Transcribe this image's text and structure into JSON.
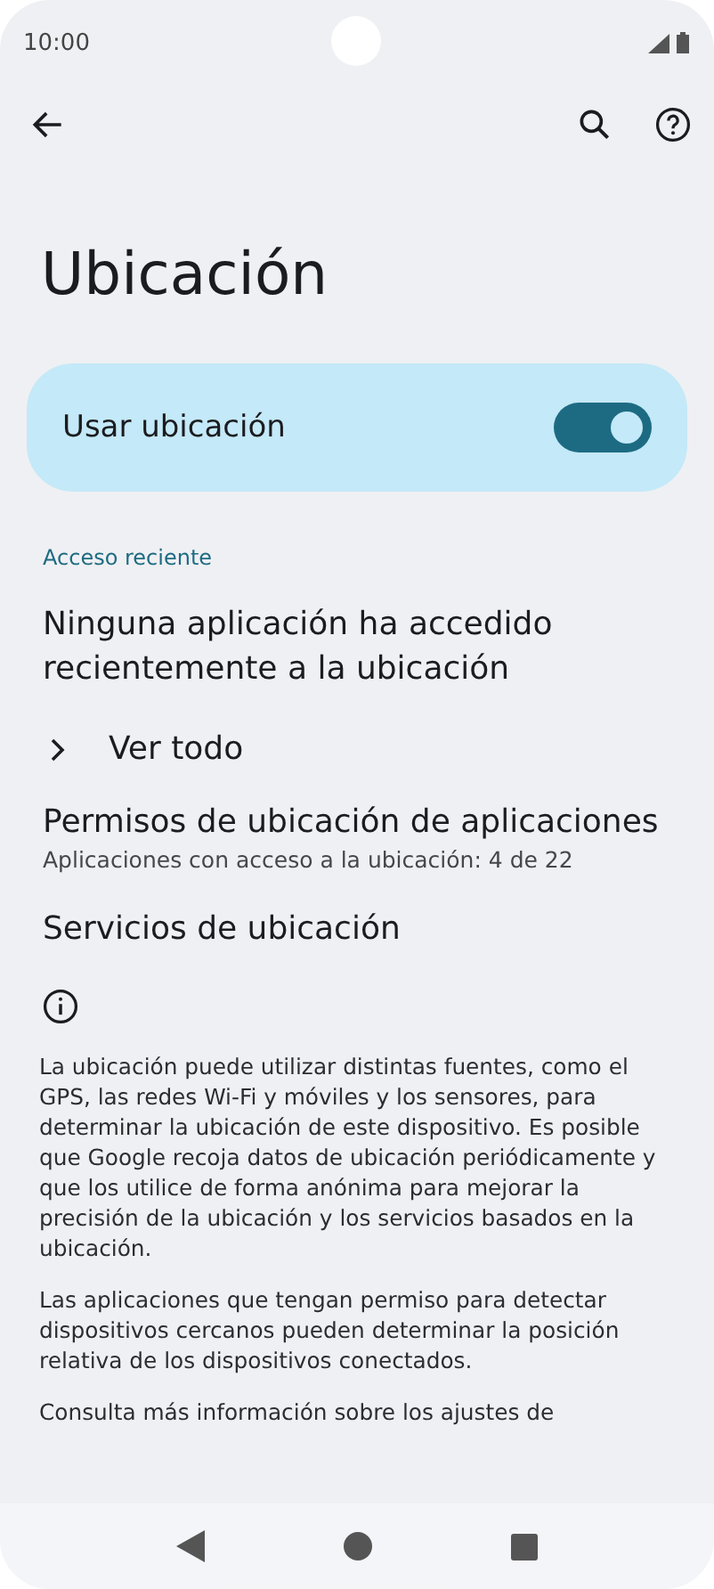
{
  "status_bar": {
    "time": "10:00"
  },
  "title": "Ubicación",
  "main_toggle": {
    "label": "Usar ubicación",
    "on": true
  },
  "section_header": "Acceso reciente",
  "recent_message": "Ninguna aplicación ha accedido recientemente a la ubicación",
  "see_all": {
    "label": "Ver todo"
  },
  "items": [
    {
      "title": "Permisos de ubicación de aplicaciones",
      "subtitle": "Aplicaciones con acceso a la ubicación: 4 de 22"
    },
    {
      "title": "Servicios de ubicación"
    }
  ],
  "footer_paragraphs": [
    "La ubicación puede utilizar distintas fuentes, como el GPS, las redes Wi-Fi y móviles y los sensores, para determinar la ubicación de este dispositivo. Es posible que Google recoja datos de ubicación periódicamente y que los utilice de forma anónima para mejorar la precisión de la ubicación y los servicios basados en la ubicación.",
    "Las aplicaciones que tengan permiso para detectar dispositivos cercanos pueden determinar la posición relativa de los dispositivos conectados.",
    "Consulta más información sobre los ajustes de"
  ]
}
